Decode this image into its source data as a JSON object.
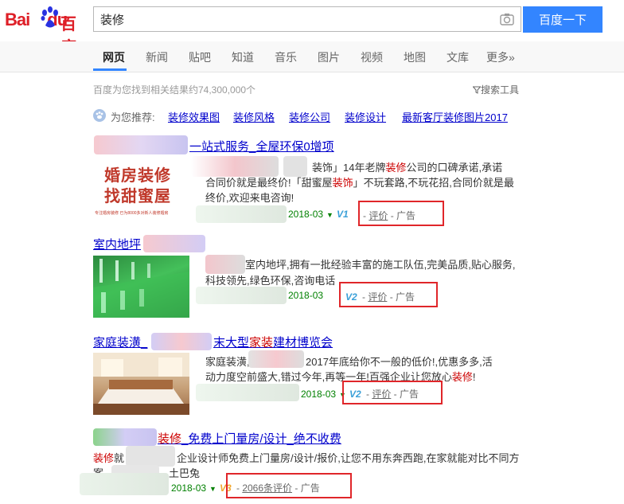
{
  "header": {
    "logo_text": "Bai",
    "logo_text2": "du",
    "logo_cn": "百度",
    "search_value": "装修",
    "search_button": "百度一下"
  },
  "tabs": [
    {
      "label": "网页",
      "active": true
    },
    {
      "label": "新闻"
    },
    {
      "label": "贴吧"
    },
    {
      "label": "知道"
    },
    {
      "label": "音乐"
    },
    {
      "label": "图片"
    },
    {
      "label": "视频"
    },
    {
      "label": "地图"
    },
    {
      "label": "文库"
    },
    {
      "label": "更多»"
    }
  ],
  "result_count": "百度为您找到相关结果约74,300,000个",
  "search_tools": "搜索工具",
  "recommend": {
    "label": "为您推荐:",
    "links": [
      "装修效果图",
      "装修风格",
      "装修公司",
      "装修设计",
      "最新客厅装修图片2017"
    ]
  },
  "results": [
    {
      "title": "一站式服务_全屋环保0增项",
      "text1_a": "装饰」14年老牌",
      "text1_em": "装修",
      "text1_b": "公司的口碑承诺,承诺",
      "text2_a": "合同价就是最终价!「甜蜜屋",
      "text2_em": "装饰",
      "text2_b": "」不玩套路,不玩花招,合同价就是最",
      "text3": "终价,欢迎来电咨询!",
      "thumb_line1": "婚房装修",
      "thumb_line2": "找甜蜜屋",
      "thumb_line3": "专注婚房装修   已为8000多对新人装修婚房",
      "date": "2018-03",
      "badge": "V1",
      "review": "评价",
      "ad": "广告"
    },
    {
      "title": "室内地坪",
      "text1": "室内地坪,拥有一批经验丰富的施工队伍,完美品质,贴心服务,",
      "text2": "科技领先,绿色环保,咨询电话",
      "date": "2018-03",
      "badge": "V2",
      "review": "评价",
      "ad": "广告"
    },
    {
      "title_a": "家庭装潢_",
      "title_b": "末大型",
      "title_em": "家装",
      "title_c": "建材博览会",
      "text1_a": "家庭装潢,",
      "text1_b": "2017年底给你不一般的低价!,优惠多多,活",
      "text2_a": "动力度空前盛大,错过今年,再等一年!百强企业让您放心",
      "text2_em": "装修",
      "text2_b": "!",
      "date": "2018-03",
      "badge": "V2",
      "review": "评价",
      "ad": "广告"
    },
    {
      "title_em": "装修",
      "title_b": "_免费上门量房/设计_绝不收费",
      "text1_em": "装修",
      "text1_a": "就",
      "text1_b": "企业设计师免费上门量房/设计/报价,让您不用东奔西跑,在家就能对比不同方",
      "text2_a": "案,",
      "text2_b": "土巴兔",
      "date": "2018-03",
      "badge": "V3",
      "review": "2066条评价",
      "ad": "广告"
    }
  ],
  "colors": {
    "brand_red": "#de1f27",
    "link_blue": "#00c",
    "button_blue": "#3385ff",
    "highlight_red": "#c00",
    "url_green": "#008000",
    "annotation_red": "#e0262a"
  }
}
